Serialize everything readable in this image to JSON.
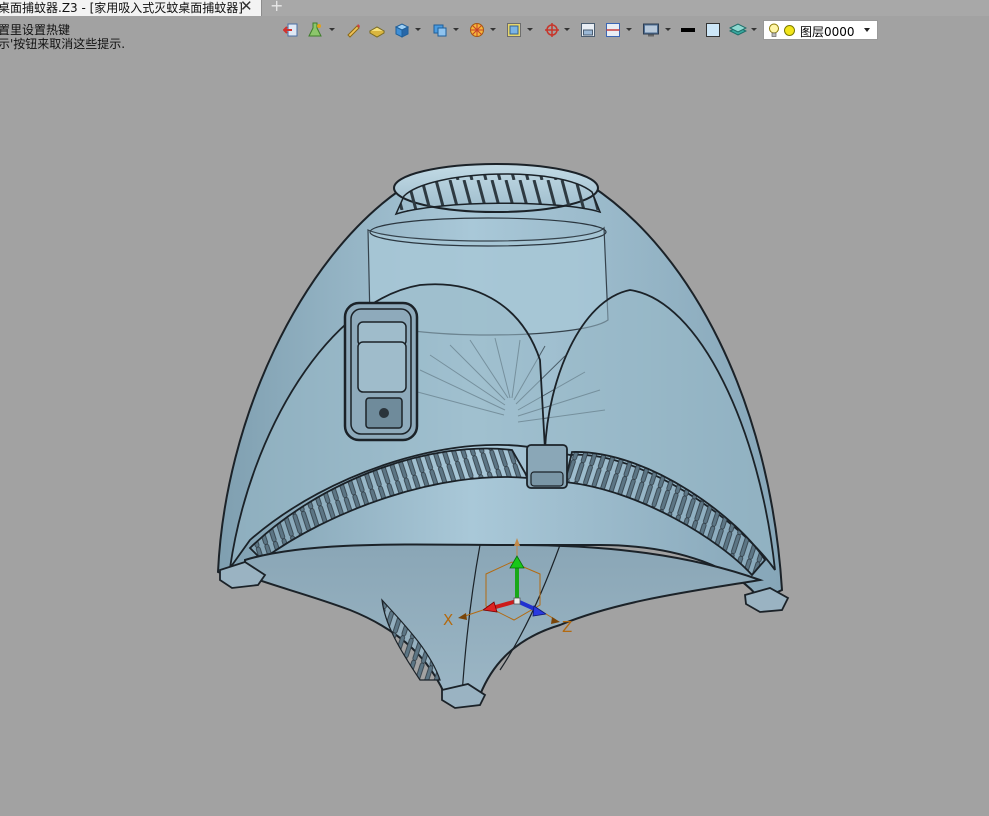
{
  "tab": {
    "title": "桌面捕蚊器.Z3 - [家用吸入式灭蚊桌面捕蚊器]",
    "close_icon": "close-icon",
    "new_tab_icon": "plus-icon",
    "new_tab_glyph": "+"
  },
  "hints": {
    "line1": "置里设置热键",
    "line2": "示'按钮来取消这些提示."
  },
  "toolbar": {
    "layer": {
      "name": "图层0000",
      "bulb_icon": "lightbulb-icon",
      "color": "#f2e51a"
    },
    "tools": [
      "exit-icon",
      "flask-icon",
      "pen-icon",
      "eraser-block-icon",
      "cube-icon",
      "shaded-box-icon",
      "render-wheel-icon",
      "view-frame-icon",
      "target-icon",
      "single-view-icon",
      "split-view-icon",
      "display-monitor-icon",
      "line-color-icon",
      "fill-color-icon",
      "layer-stack-icon"
    ]
  },
  "viewport": {
    "background": "#a2a2a2",
    "axis": {
      "x_label": "X",
      "z_label": "Z"
    }
  }
}
